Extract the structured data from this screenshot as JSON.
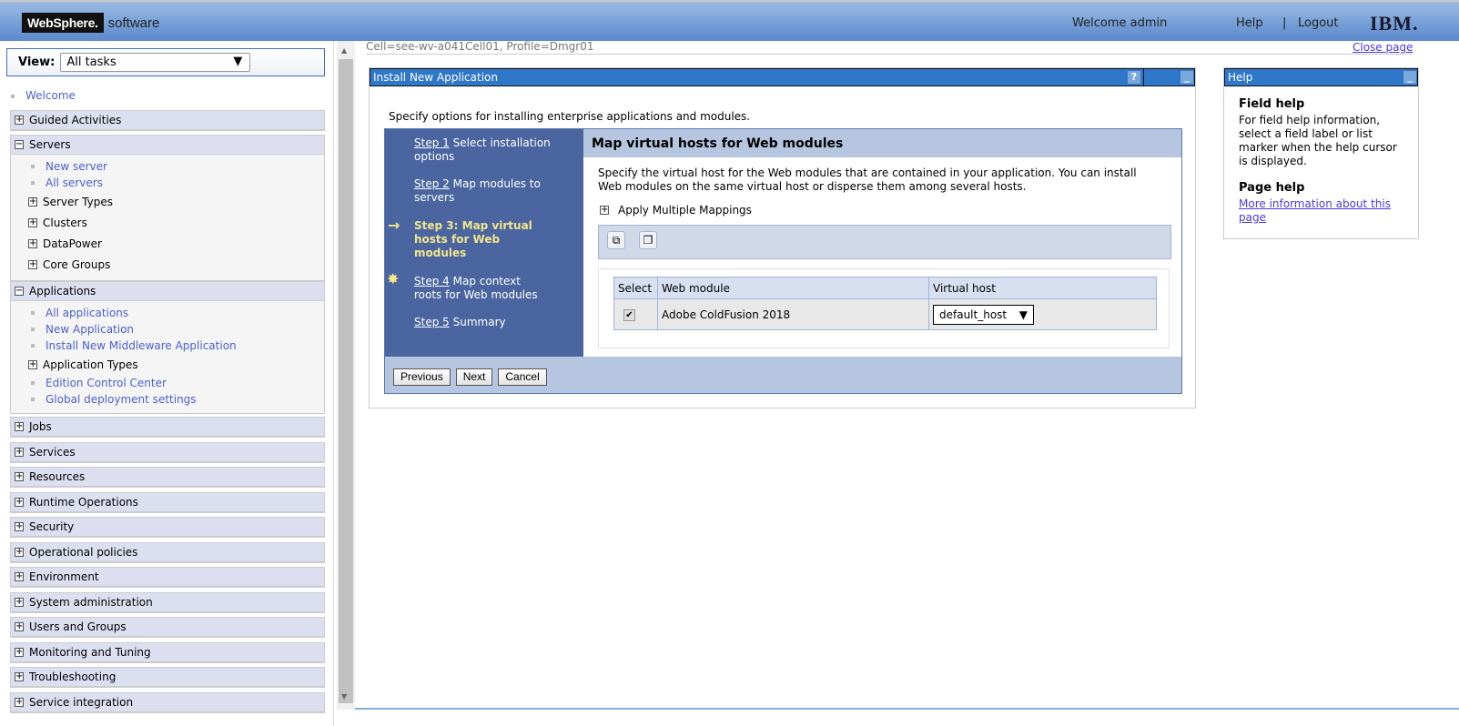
{
  "header": {
    "brand_box": "WebSphere.",
    "brand_text": "software",
    "welcome": "Welcome admin",
    "help": "Help",
    "separator": "|",
    "logout": "Logout",
    "ibm_logo": "IBM."
  },
  "sidebar": {
    "view_label": "View:",
    "view_value": "All tasks",
    "welcome": "Welcome",
    "sections": [
      {
        "label": "Guided Activities",
        "expanded": false
      },
      {
        "label": "Servers",
        "expanded": true,
        "items": [
          {
            "label": "New server",
            "type": "link"
          },
          {
            "label": "All servers",
            "type": "link"
          },
          {
            "label": "Server Types",
            "type": "tree"
          },
          {
            "label": "Clusters",
            "type": "tree"
          },
          {
            "label": "DataPower",
            "type": "tree"
          },
          {
            "label": "Core Groups",
            "type": "tree"
          }
        ]
      },
      {
        "label": "Applications",
        "expanded": true,
        "items": [
          {
            "label": "All applications",
            "type": "link"
          },
          {
            "label": "New Application",
            "type": "link"
          },
          {
            "label": "Install New Middleware Application",
            "type": "link"
          },
          {
            "label": "Application Types",
            "type": "tree"
          },
          {
            "label": "Edition Control Center",
            "type": "link"
          },
          {
            "label": "Global deployment settings",
            "type": "link"
          }
        ]
      },
      {
        "label": "Jobs"
      },
      {
        "label": "Services"
      },
      {
        "label": "Resources"
      },
      {
        "label": "Runtime Operations"
      },
      {
        "label": "Security"
      },
      {
        "label": "Operational policies"
      },
      {
        "label": "Environment"
      },
      {
        "label": "System administration"
      },
      {
        "label": "Users and Groups"
      },
      {
        "label": "Monitoring and Tuning"
      },
      {
        "label": "Troubleshooting"
      },
      {
        "label": "Service integration"
      }
    ]
  },
  "main": {
    "cell": "Cell=see-wv-a041Cell01, Profile=Dmgr01",
    "close_page": "Close page",
    "panel_title": "Install New Application",
    "help_btn": "?",
    "min_btn": "_",
    "intro": "Specify options for installing enterprise applications and modules.",
    "steps": [
      {
        "num": "Step 1",
        "text": "Select installation options"
      },
      {
        "num": "Step 2",
        "text": "Map modules to servers"
      },
      {
        "num": "Step 3:",
        "text": "Map virtual hosts for Web modules",
        "current": true
      },
      {
        "num": "Step 4",
        "text": "Map context roots for Web modules"
      },
      {
        "num": "Step 5",
        "text": "Summary"
      }
    ],
    "content_title": "Map virtual hosts for Web modules",
    "description": "Specify the virtual host for the Web modules that are contained in your application. You can install Web modules on the same virtual host or disperse them among several hosts.",
    "apply_multiple": "Apply Multiple Mappings",
    "table": {
      "headers": [
        "Select",
        "Web module",
        "Virtual host"
      ],
      "rows": [
        {
          "selected": true,
          "module": "Adobe ColdFusion 2018",
          "host": "default_host"
        }
      ]
    },
    "buttons": {
      "previous": "Previous",
      "next": "Next",
      "cancel": "Cancel"
    }
  },
  "help": {
    "title": "Help",
    "field_help_title": "Field help",
    "field_help_text": "For field help information, select a field label or list marker when the help cursor is displayed.",
    "page_help_title": "Page help",
    "page_help_link": "More information about this page"
  }
}
